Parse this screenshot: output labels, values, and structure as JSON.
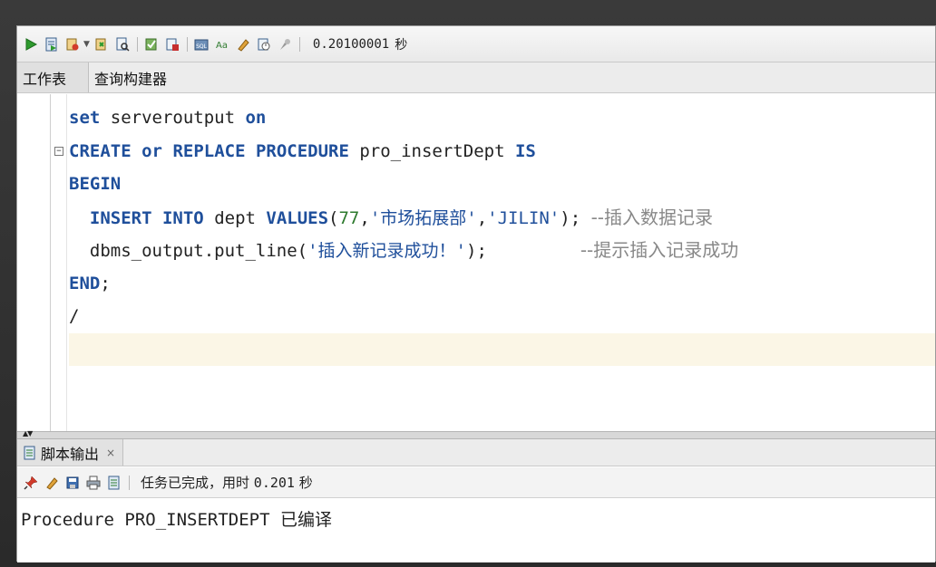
{
  "toolbar": {
    "icons": [
      "run-statement-icon",
      "run-script-icon",
      "commit-icon",
      "rollback-icon",
      "explain-plan-icon",
      "autotrace-icon",
      "sql-tuning-icon",
      "clear-icon",
      "history-icon",
      "format-icon",
      "unshared-icon"
    ],
    "execution_time": "0.20100001",
    "time_unit": "秒"
  },
  "tabs": [
    {
      "label": "工作表"
    },
    {
      "label": "查询构建器"
    }
  ],
  "editor": {
    "lines": [
      {
        "parts": [
          {
            "t": "kw",
            "v": "set"
          },
          {
            "t": "plain",
            "v": " serveroutput "
          },
          {
            "t": "kw",
            "v": "on"
          }
        ]
      },
      {
        "parts": [
          {
            "t": "kw",
            "v": "CREATE"
          },
          {
            "t": "plain",
            "v": " "
          },
          {
            "t": "kw",
            "v": "or"
          },
          {
            "t": "plain",
            "v": " "
          },
          {
            "t": "kw",
            "v": "REPLACE"
          },
          {
            "t": "plain",
            "v": " "
          },
          {
            "t": "kw",
            "v": "PROCEDURE"
          },
          {
            "t": "plain",
            "v": " pro_insertDept "
          },
          {
            "t": "kw",
            "v": "IS"
          }
        ],
        "fold": "⊟"
      },
      {
        "parts": [
          {
            "t": "kw",
            "v": "BEGIN"
          }
        ]
      },
      {
        "parts": [
          {
            "t": "plain",
            "v": "  "
          },
          {
            "t": "kw",
            "v": "INSERT"
          },
          {
            "t": "plain",
            "v": " "
          },
          {
            "t": "kw",
            "v": "INTO"
          },
          {
            "t": "plain",
            "v": " dept "
          },
          {
            "t": "kw",
            "v": "VALUES"
          },
          {
            "t": "plain",
            "v": "("
          },
          {
            "t": "num",
            "v": "77"
          },
          {
            "t": "plain",
            "v": ","
          },
          {
            "t": "str",
            "v": "'市场拓展部'"
          },
          {
            "t": "plain",
            "v": ","
          },
          {
            "t": "str",
            "v": "'JILIN'"
          },
          {
            "t": "plain",
            "v": "); "
          },
          {
            "t": "cmt",
            "v": "--插入数据记录"
          }
        ]
      },
      {
        "parts": [
          {
            "t": "plain",
            "v": "  dbms_output.put_line("
          },
          {
            "t": "str",
            "v": "'插入新记录成功！'"
          },
          {
            "t": "plain",
            "v": ");         "
          },
          {
            "t": "cmt",
            "v": "--提示插入记录成功"
          }
        ]
      },
      {
        "parts": [
          {
            "t": "kw",
            "v": "END"
          },
          {
            "t": "plain",
            "v": ";"
          }
        ]
      },
      {
        "parts": [
          {
            "t": "plain",
            "v": "/"
          }
        ]
      },
      {
        "parts": [],
        "highlight": true
      }
    ]
  },
  "output": {
    "tab_label": "脚本输出",
    "close_glyph": "×",
    "icons": [
      "pin-icon",
      "eraser-icon",
      "save-icon",
      "print-icon",
      "save-script-icon"
    ],
    "status": "任务已完成，用时",
    "status_time": "0.201",
    "status_unit": "秒",
    "content": "Procedure PRO_INSERTDEPT 已编译"
  },
  "colors": {
    "keyword": "#1f4f9b",
    "number": "#2d7a2d",
    "comment": "#888888",
    "highlight_line": "#fbf6e6"
  }
}
